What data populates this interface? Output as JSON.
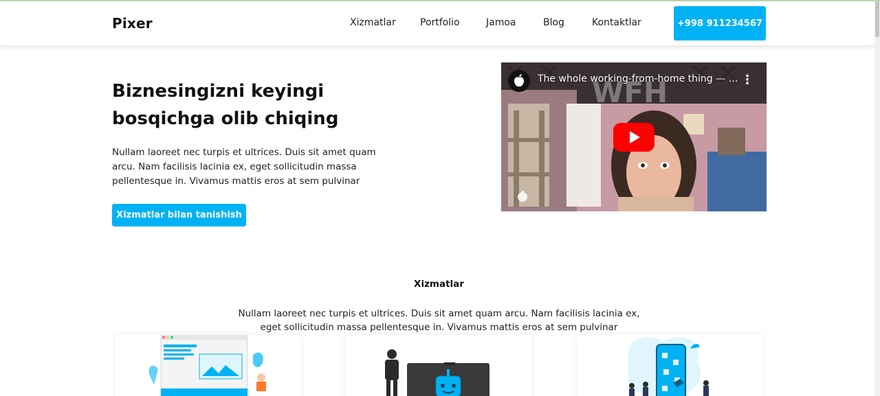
{
  "header": {
    "logo": "Pixer",
    "nav": [
      "Xizmatlar",
      "Portfolio",
      "Jamoa",
      "Blog",
      "Kontaktlar"
    ],
    "phone": "+998 911234567"
  },
  "hero": {
    "title": "Biznesingizni keyingi bosqichga olib chiqing",
    "text": "Nullam laoreet nec turpis et ultrices. Duis sit amet quam arcu. Nam facilisis lacinia ex, eget sollicitudin massa pellentesque in. Vivamus mattis eros at sem pulvinar",
    "button": "Xizmatlar bilan tanishish"
  },
  "video": {
    "title": "The whole working-from-home thing — Apple",
    "overlay_text": "WFH",
    "icons": [
      "apple-logo-icon",
      "more-vertical-icon",
      "youtube-play-icon"
    ]
  },
  "services": {
    "title": "Xizmatlar",
    "text": "Nullam laoreet nec turpis et ultrices. Duis sit amet quam arcu. Nam facilisis lacinia ex, eget sollicitudin massa pellentesque in. Vivamus mattis eros at sem pulvinar"
  },
  "colors": {
    "accent": "#00b2f4",
    "youtube_red": "#ff0000"
  }
}
